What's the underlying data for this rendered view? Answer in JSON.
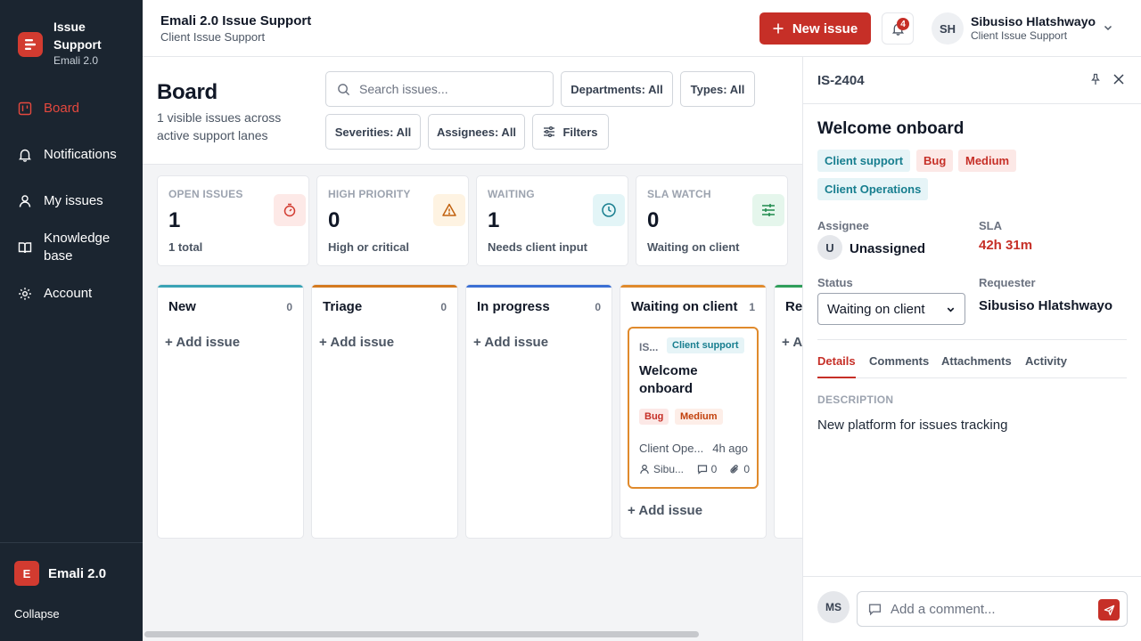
{
  "brand": {
    "title": "Issue Support",
    "subtitle": "Emali 2.0"
  },
  "sidebar": {
    "items": [
      {
        "label": "Board",
        "icon": "board-icon",
        "active": true
      },
      {
        "label": "Notifications",
        "icon": "bell-icon"
      },
      {
        "label": "My issues",
        "icon": "user-icon"
      },
      {
        "label": "Knowledge base",
        "icon": "book-icon"
      },
      {
        "label": "Account",
        "icon": "gear-icon"
      }
    ],
    "footer": {
      "logo_letter": "E",
      "name": "Emali 2.0",
      "collapse": "Collapse"
    }
  },
  "header": {
    "title": "Emali 2.0 Issue Support",
    "subtitle": "Client Issue Support",
    "new_issue": "New issue",
    "notification_count": "4",
    "user": {
      "initials": "SH",
      "name": "Sibusiso Hlatshwayo",
      "role": "Client Issue Support"
    }
  },
  "board": {
    "title": "Board",
    "subtitle": "1 visible issues across active support lanes",
    "search_placeholder": "Search issues...",
    "filters": {
      "departments": "Departments: All",
      "types": "Types: All",
      "severities": "Severities: All",
      "assignees": "Assignees: All",
      "more": "Filters"
    },
    "stats": [
      {
        "label": "OPEN ISSUES",
        "value": "1",
        "sub": "1 total",
        "icon": "timer-icon",
        "color": "#d23b30"
      },
      {
        "label": "HIGH PRIORITY",
        "value": "0",
        "sub": "High or critical",
        "icon": "warning-icon",
        "color": "#c2620f"
      },
      {
        "label": "WAITING",
        "value": "1",
        "sub": "Needs client input",
        "icon": "clock-icon",
        "color": "#177e8f"
      },
      {
        "label": "SLA WATCH",
        "value": "0",
        "sub": "Waiting on client",
        "icon": "sliders-icon",
        "color": "#1f8a4c"
      }
    ],
    "columns": [
      {
        "title": "New",
        "count": "0",
        "add": "+ Add issue",
        "color": "#3aa3b5"
      },
      {
        "title": "Triage",
        "count": "0",
        "add": "+ Add issue",
        "color": "#d47a20"
      },
      {
        "title": "In progress",
        "count": "0",
        "add": "+ Add issue",
        "color": "#3b6fd4"
      },
      {
        "title": "Waiting on client",
        "count": "1",
        "add": "+ Add issue",
        "color": "#e08a2c"
      },
      {
        "title": "Res",
        "add": "+ A",
        "color": "#2f9e5a"
      }
    ],
    "card": {
      "id": "IS...",
      "department": "Client support",
      "title": "Welcome onboard",
      "type": "Bug",
      "severity": "Medium",
      "team": "Client Ope...",
      "time": "4h ago",
      "assignee": "Sibu...",
      "comments": "0",
      "attachments": "0"
    }
  },
  "panel": {
    "id": "IS-2404",
    "title": "Welcome onboard",
    "chips": [
      "Client support",
      "Bug",
      "Medium",
      "Client Operations"
    ],
    "assignee_label": "Assignee",
    "assignee_initial": "U",
    "assignee": "Unassigned",
    "sla_label": "SLA",
    "sla": "42h 31m",
    "status_label": "Status",
    "status": "Waiting on client",
    "requester_label": "Requester",
    "requester": "Sibusiso Hlatshwayo",
    "tabs": [
      "Details",
      "Comments",
      "Attachments",
      "Activity"
    ],
    "description_label": "DESCRIPTION",
    "description": "New platform for issues tracking",
    "commenter_initials": "MS",
    "comment_placeholder": "Add a comment..."
  }
}
